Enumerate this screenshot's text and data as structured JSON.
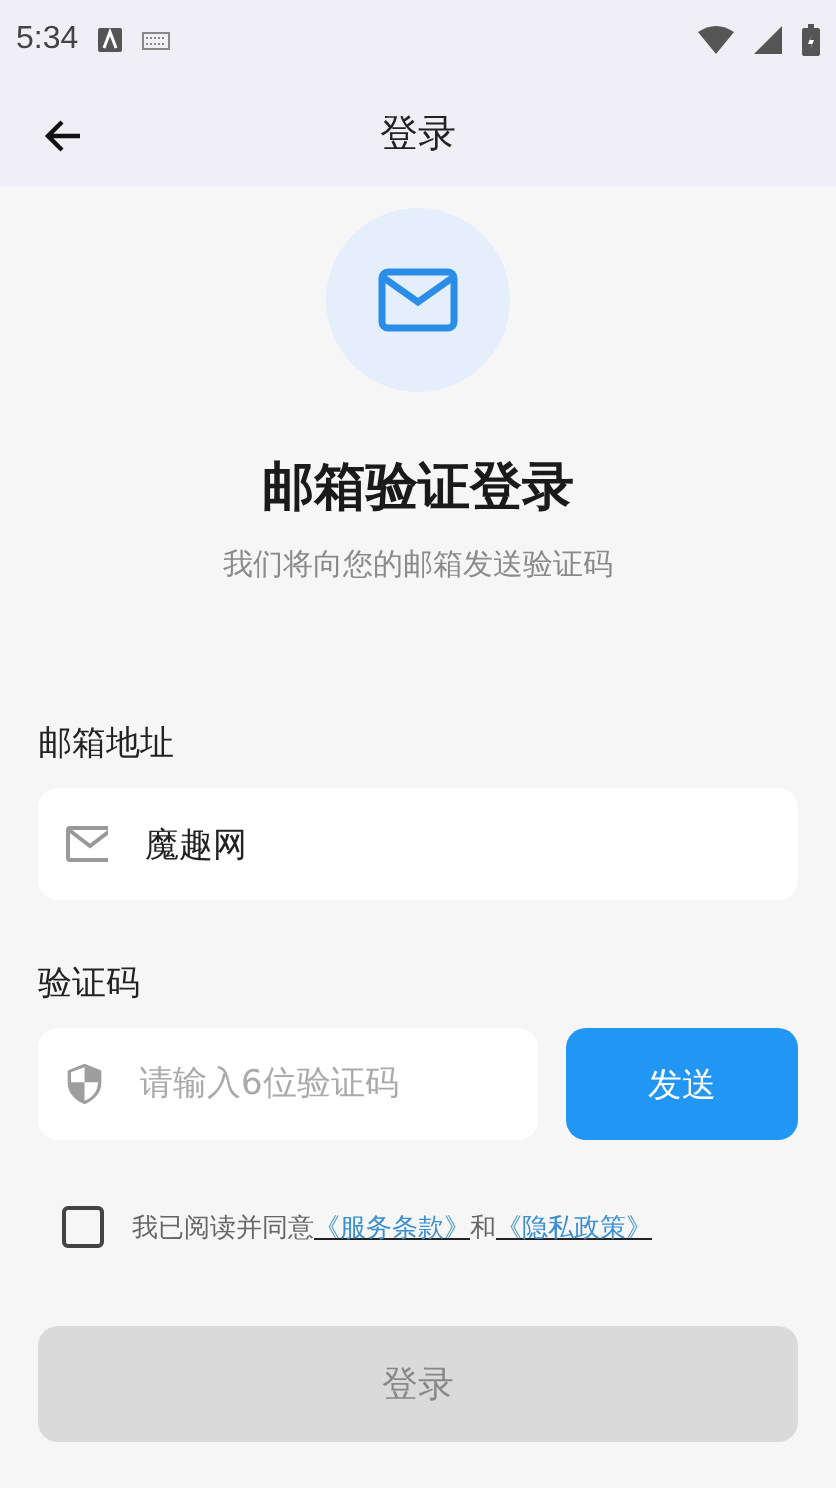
{
  "status_bar": {
    "time": "5:34"
  },
  "app_bar": {
    "title": "登录"
  },
  "header": {
    "title": "邮箱验证登录",
    "subtitle": "我们将向您的邮箱发送验证码"
  },
  "email": {
    "label": "邮箱地址",
    "value": "魔趣网"
  },
  "code": {
    "label": "验证码",
    "placeholder": "请输入6位验证码",
    "send_button": "发送"
  },
  "agreement": {
    "checked": false,
    "text": "我已阅读并同意",
    "link_1": "《服务条款》",
    "joiner": "和",
    "link_2": "《隐私政策》"
  },
  "login_button": {
    "label": "登录",
    "disabled": true
  }
}
